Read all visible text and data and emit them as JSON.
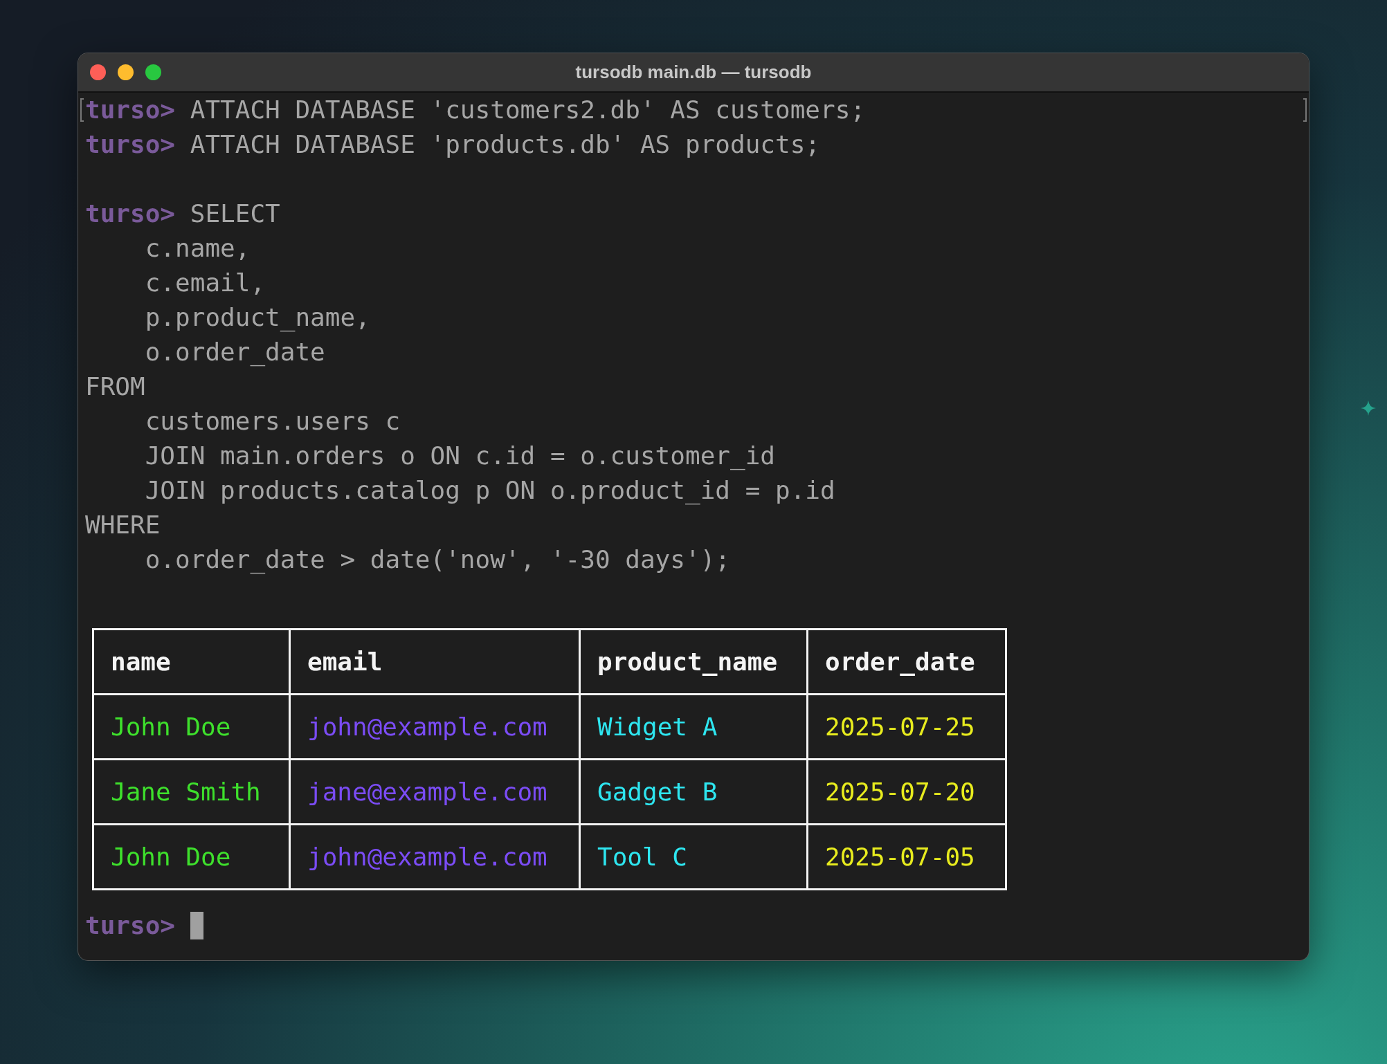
{
  "window": {
    "title": "tursodb main.db — tursodb"
  },
  "lines": [
    {
      "kind": "prompt",
      "prompt": "turso>",
      "text": "ATTACH DATABASE 'customers2.db' AS customers;"
    },
    {
      "kind": "prompt",
      "prompt": "turso>",
      "text": "ATTACH DATABASE 'products.db' AS products;"
    },
    {
      "kind": "blank"
    },
    {
      "kind": "prompt",
      "prompt": "turso>",
      "text": "SELECT"
    },
    {
      "kind": "code",
      "text": "    c.name,"
    },
    {
      "kind": "code",
      "text": "    c.email,"
    },
    {
      "kind": "code",
      "text": "    p.product_name,"
    },
    {
      "kind": "code",
      "text": "    o.order_date"
    },
    {
      "kind": "code",
      "text": "FROM"
    },
    {
      "kind": "code",
      "text": "    customers.users c"
    },
    {
      "kind": "code",
      "text": "    JOIN main.orders o ON c.id = o.customer_id"
    },
    {
      "kind": "code",
      "text": "    JOIN products.catalog p ON o.product_id = p.id"
    },
    {
      "kind": "code",
      "text": "WHERE"
    },
    {
      "kind": "code",
      "text": "    o.order_date > date('now', '-30 days');"
    }
  ],
  "table": {
    "columns": [
      {
        "label": "name",
        "color": "#3ee02c"
      },
      {
        "label": "email",
        "color": "#7b4cf5"
      },
      {
        "label": "product_name",
        "color": "#2ee6f0"
      },
      {
        "label": "order_date",
        "color": "#e8ec1e"
      }
    ],
    "rows": [
      [
        "John Doe",
        "john@example.com",
        "Widget A",
        "2025-07-25"
      ],
      [
        "Jane Smith",
        "jane@example.com",
        "Gadget B",
        "2025-07-20"
      ],
      [
        "John Doe",
        "john@example.com",
        "Tool C",
        "2025-07-05"
      ]
    ]
  },
  "input": {
    "prompt": "turso>"
  }
}
